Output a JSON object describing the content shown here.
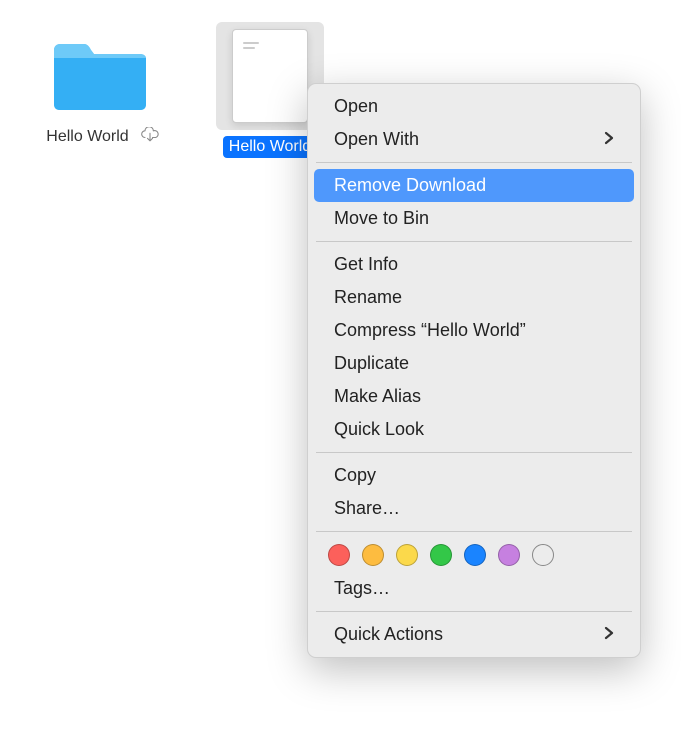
{
  "desktop": {
    "items": [
      {
        "label": "Hello World",
        "type": "folder",
        "hasCloud": true,
        "selected": false
      },
      {
        "label": "Hello World",
        "type": "document",
        "hasCloud": false,
        "selected": true
      }
    ]
  },
  "contextMenu": {
    "items": [
      {
        "label": "Open",
        "submenu": false
      },
      {
        "label": "Open With",
        "submenu": true
      }
    ],
    "itemsGroup2": [
      {
        "label": "Remove Download",
        "highlighted": true
      },
      {
        "label": "Move to Bin"
      }
    ],
    "itemsGroup3": [
      {
        "label": "Get Info"
      },
      {
        "label": "Rename"
      },
      {
        "label": "Compress “Hello World”"
      },
      {
        "label": "Duplicate"
      },
      {
        "label": "Make Alias"
      },
      {
        "label": "Quick Look"
      }
    ],
    "itemsGroup4": [
      {
        "label": "Copy"
      },
      {
        "label": "Share…"
      }
    ],
    "tags": {
      "colors": [
        "#fc605b",
        "#fdbc40",
        "#fbd94b",
        "#33c748",
        "#1a84ff",
        "#c680e0"
      ],
      "label": "Tags…"
    },
    "itemsGroup5": [
      {
        "label": "Quick Actions",
        "submenu": true
      }
    ]
  }
}
